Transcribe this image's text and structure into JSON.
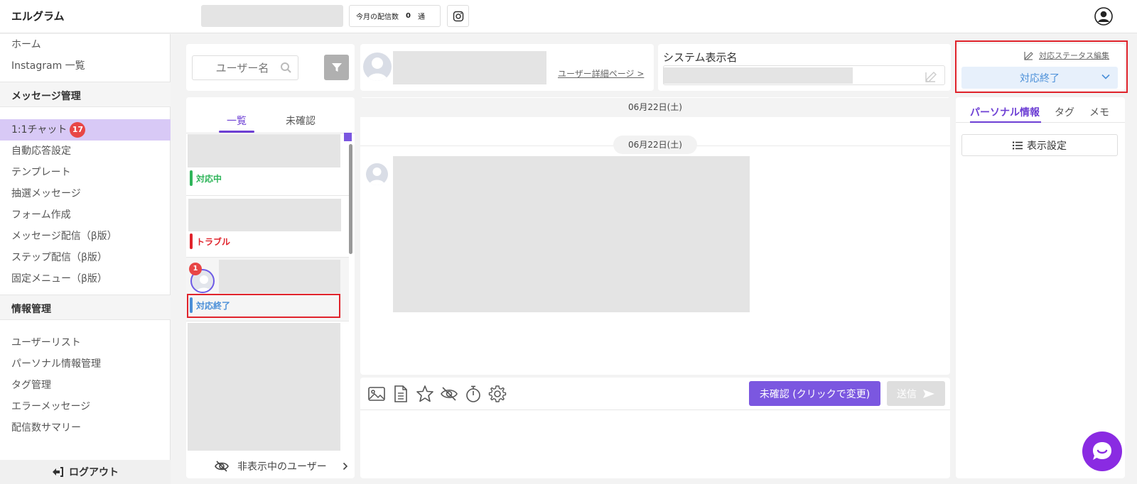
{
  "header": {
    "logo": "エルグラム",
    "count_label": "今月の配信数",
    "count_value": "0",
    "count_unit": "通"
  },
  "sidebar": {
    "items_top": [
      {
        "label": "ホーム"
      },
      {
        "label": "Instagram 一覧"
      }
    ],
    "section_message": "メッセージ管理",
    "items_message": [
      {
        "label": "1:1チャット",
        "badge": "17"
      },
      {
        "label": "自動応答設定"
      },
      {
        "label": "テンプレート"
      },
      {
        "label": "抽選メッセージ"
      },
      {
        "label": "フォーム作成"
      },
      {
        "label": "メッセージ配信（β版）"
      },
      {
        "label": "ステップ配信（β版）"
      },
      {
        "label": "固定メニュー（β版）"
      }
    ],
    "section_info": "情報管理",
    "items_info": [
      {
        "label": "ユーザーリスト"
      },
      {
        "label": "パーソナル情報管理"
      },
      {
        "label": "タグ管理"
      },
      {
        "label": "エラーメッセージ"
      },
      {
        "label": "配信数サマリー"
      }
    ],
    "logout": "ログアウト"
  },
  "list": {
    "search_placeholder": "ユーザー名",
    "tabs": [
      "一覧",
      "未確認"
    ],
    "conversations": [
      {
        "status": "対応中",
        "color": "#2fb55a"
      },
      {
        "status": "トラブル",
        "color": "#e0232b"
      },
      {
        "status": "対応終了",
        "color": "#4a8fd8",
        "badge": "1"
      }
    ],
    "hidden_users": "非表示中のユーザー"
  },
  "user": {
    "detail_link": "ユーザー詳細ページ >",
    "system_name_label": "システム表示名"
  },
  "chat": {
    "date_bar": "06月22日(土)",
    "date_pill": "06月22日(土)",
    "unconfirm_button": "未確認 (クリックで変更)",
    "send_button": "送信"
  },
  "right": {
    "status_edit": "対応ステータス編集",
    "status_value": "対応終了",
    "tabs": [
      "パーソナル情報",
      "タグ",
      "メモ"
    ],
    "display_settings": "表示設定"
  },
  "colors": {
    "accent": "#7b57e0",
    "highlight": "#e0232b",
    "status_blue": "#4a8fd8"
  }
}
